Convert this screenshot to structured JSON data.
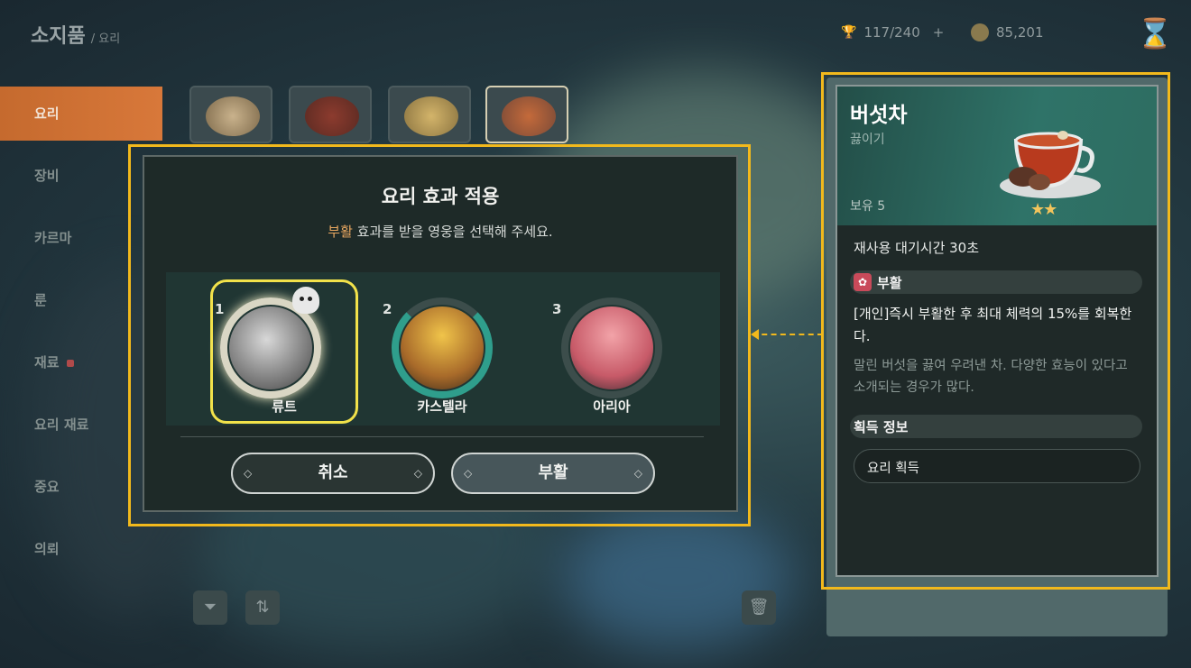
{
  "header": {
    "title": "소지품",
    "breadcrumb": "/ 요리",
    "capacity": "117/240",
    "capacity_plus": "+",
    "currency": "85,201"
  },
  "sidebar": {
    "items": [
      {
        "label": "요리",
        "active": true
      },
      {
        "label": "장비"
      },
      {
        "label": "카르마"
      },
      {
        "label": "룬"
      },
      {
        "label": "재료",
        "badge": true
      },
      {
        "label": "요리 재료"
      },
      {
        "label": "중요"
      },
      {
        "label": "의뢰"
      }
    ]
  },
  "food_list": [
    "food-item-1",
    "food-item-2",
    "food-item-3",
    "food-item-4"
  ],
  "modal": {
    "title": "요리 효과 적용",
    "subtitle_accent": "부활",
    "subtitle_rest": " 효과를 받을 영웅을 선택해 주세요.",
    "heroes": [
      {
        "num": "1",
        "name": "류트",
        "selected": true
      },
      {
        "num": "2",
        "name": "카스텔라"
      },
      {
        "num": "3",
        "name": "아리아"
      }
    ],
    "cancel_label": "취소",
    "confirm_label": "부활"
  },
  "item": {
    "name": "버섯차",
    "type": "끓이기",
    "owned": "보유 5",
    "stars": "★★",
    "cooldown": "재사용 대기시간 30초",
    "effect_name": "부활",
    "effect_desc": "[개인]즉시 부활한 후 최대 체력의 15%를 회복한다.",
    "flavor": "말린 버섯을 끓여 우려낸 차. 다양한 효능이 있다고 소개되는 경우가 많다.",
    "acquire_header": "획득 정보",
    "acquire_source": "요리 획득"
  },
  "colors": {
    "highlight": "#f2b91c",
    "active_tab": "#d8783a",
    "accent_text": "#e8a760",
    "select_ring": "#f2e24a",
    "star": "#f3c45c"
  }
}
